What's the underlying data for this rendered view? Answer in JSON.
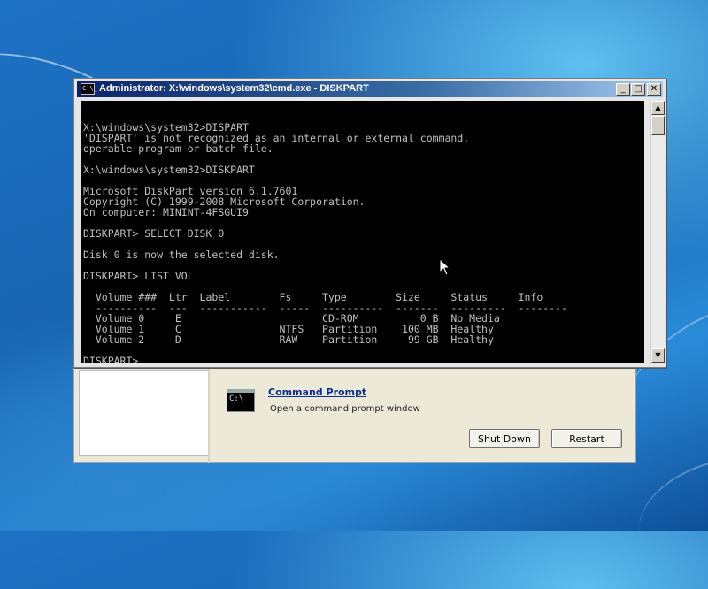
{
  "window": {
    "title": "Administrator: X:\\windows\\system32\\cmd.exe - DISKPART",
    "minimize": "_",
    "maximize": "□",
    "close": "✕",
    "icon_text": "C:\\_"
  },
  "console": {
    "lines": [
      "X:\\windows\\system32>DISPART",
      "'DISPART' is not recognized as an internal or external command,",
      "operable program or batch file.",
      "",
      "X:\\windows\\system32>DISKPART",
      "",
      "Microsoft DiskPart version 6.1.7601",
      "Copyright (C) 1999-2008 Microsoft Corporation.",
      "On computer: MININT-4FSGUI9",
      "",
      "DISKPART> SELECT DISK 0",
      "",
      "Disk 0 is now the selected disk.",
      "",
      "DISKPART> LIST VOL",
      "",
      "  Volume ###  Ltr  Label        Fs     Type        Size     Status     Info",
      "  ----------  ---  -----------  -----  ----------  -------  ---------  --------",
      "  Volume 0     E                       CD-ROM          0 B  No Media",
      "  Volume 1     C                NTFS   Partition    100 MB  Healthy",
      "  Volume 2     D                RAW    Partition     99 GB  Healthy",
      "",
      "DISKPART>"
    ]
  },
  "recovery": {
    "tool_title": "Command Prompt",
    "tool_description": "Open a command prompt window",
    "tool_icon_text": "C:\\_",
    "shutdown_label": "Shut Down",
    "restart_label": "Restart"
  }
}
